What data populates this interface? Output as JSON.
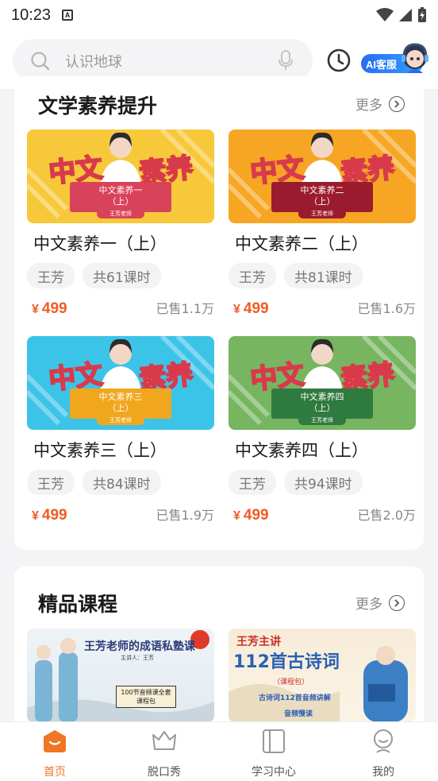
{
  "status_bar": {
    "time": "10:23",
    "notif_letter": "A"
  },
  "search": {
    "placeholder": "认识地球"
  },
  "ai_service": {
    "label": "AI客服"
  },
  "section1": {
    "title": "文学素养提升",
    "more": "更多",
    "courses": [
      {
        "name": "中文素养一（上）",
        "teacher": "王芳",
        "lessons": "共61课时",
        "price": "499",
        "sold": "已售1.1万",
        "ribbon": "中文素养一",
        "ribbon_sub": "（上）",
        "tag": "王芳老师",
        "bg": "#f7c93a",
        "ribbon_color": "#d9435a"
      },
      {
        "name": "中文素养二（上）",
        "teacher": "王芳",
        "lessons": "共81课时",
        "price": "499",
        "sold": "已售1.6万",
        "ribbon": "中文素养二",
        "ribbon_sub": "（上）",
        "tag": "王芳老师",
        "bg": "#f6a623",
        "ribbon_color": "#9b1b2e"
      },
      {
        "name": "中文素养三（上）",
        "teacher": "王芳",
        "lessons": "共84课时",
        "price": "499",
        "sold": "已售1.9万",
        "ribbon": "中文素养三",
        "ribbon_sub": "（上）",
        "tag": "王芳老师",
        "bg": "#3cc4e8",
        "ribbon_color": "#f0a71e"
      },
      {
        "name": "中文素养四（上）",
        "teacher": "王芳",
        "lessons": "共94课时",
        "price": "499",
        "sold": "已售2.0万",
        "ribbon": "中文素养四",
        "ribbon_sub": "（上）",
        "tag": "王芳老师",
        "bg": "#77b560",
        "ribbon_color": "#2f7a3e"
      }
    ],
    "currency": "¥",
    "big_left": "中文",
    "big_right": "素养"
  },
  "section2": {
    "title": "精品课程",
    "more": "更多",
    "promos": [
      {
        "title": "王芳老师的成语私塾课",
        "sub": "主讲人：王芳",
        "badge": "100节音频课全套课程包"
      },
      {
        "title_top": "王芳主讲",
        "title_main": "112首古诗词",
        "badge": "（课程包）",
        "line1": "古诗词112首音频讲解",
        "line2": "音频慢读"
      }
    ]
  },
  "tabbar": {
    "items": [
      {
        "label": "首页",
        "active": true
      },
      {
        "label": "脱口秀",
        "active": false
      },
      {
        "label": "学习中心",
        "active": false
      },
      {
        "label": "我的",
        "active": false
      }
    ]
  },
  "colors": {
    "accent": "#f07524",
    "price": "#f05b24"
  }
}
